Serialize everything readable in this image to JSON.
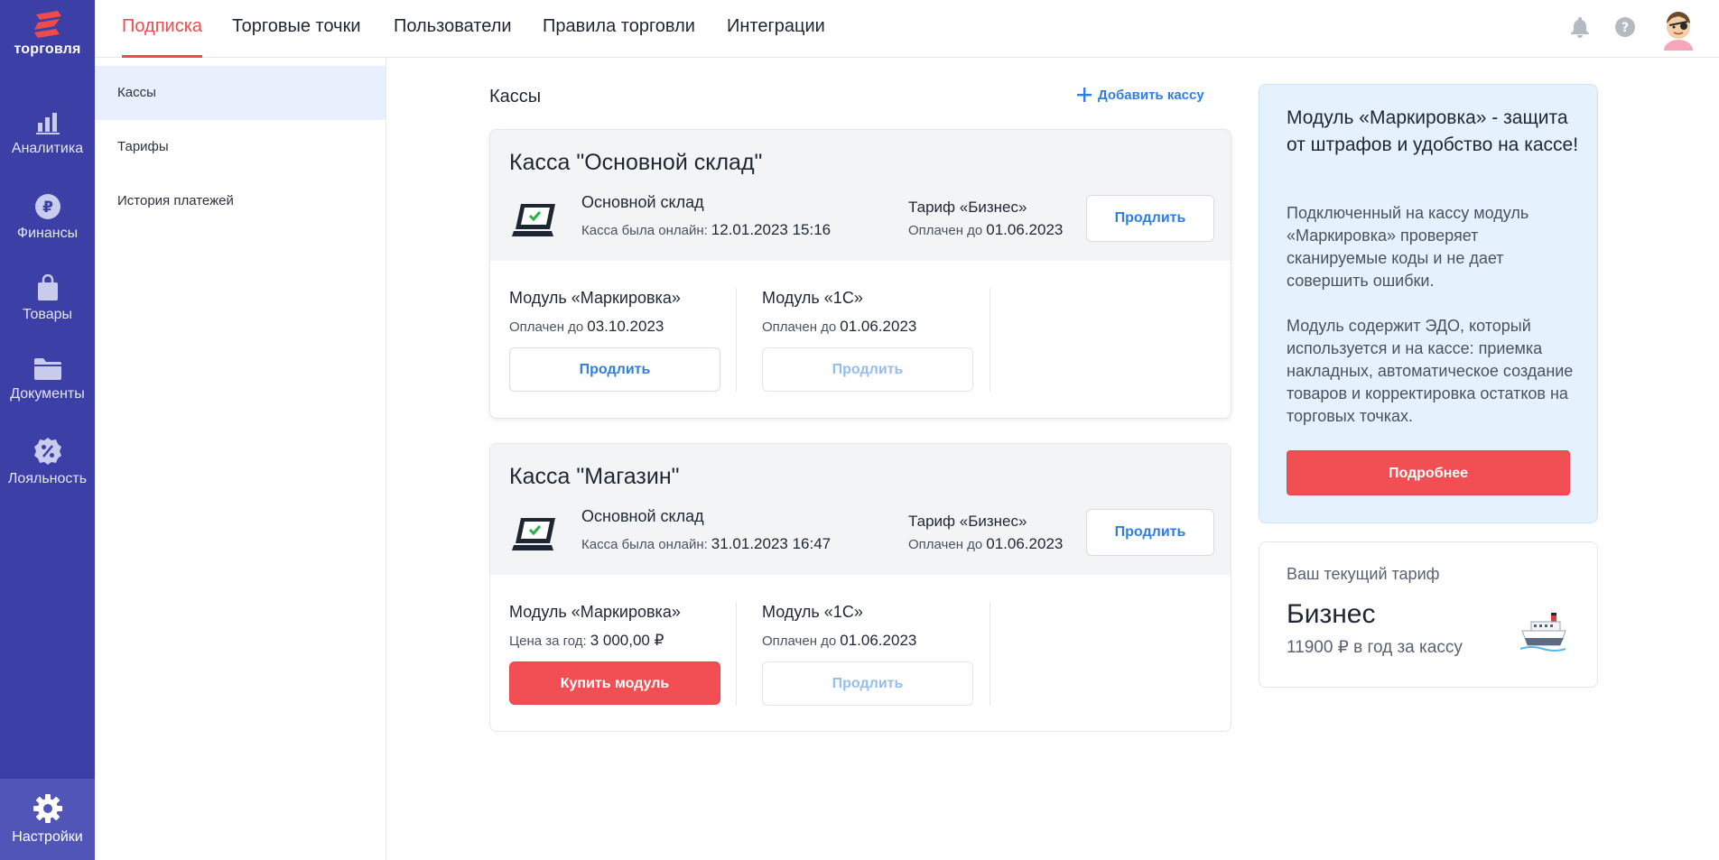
{
  "brand": {
    "logo_text": "торговля"
  },
  "rail": {
    "items": [
      {
        "label": "Аналитика",
        "icon": "chart-bar-icon"
      },
      {
        "label": "Финансы",
        "icon": "ruble-icon"
      },
      {
        "label": "Товары",
        "icon": "shopping-bag-icon"
      },
      {
        "label": "Документы",
        "icon": "folder-icon"
      },
      {
        "label": "Лояльность",
        "icon": "discount-badge-icon"
      }
    ],
    "settings": {
      "label": "Настройки",
      "icon": "gear-icon"
    }
  },
  "topnav": {
    "tabs": [
      {
        "label": "Подписка",
        "active": true
      },
      {
        "label": "Торговые точки"
      },
      {
        "label": "Пользователи"
      },
      {
        "label": "Правила торговли"
      },
      {
        "label": "Интеграции"
      }
    ]
  },
  "subnav": {
    "items": [
      {
        "label": "Кассы",
        "active": true
      },
      {
        "label": "Тарифы"
      },
      {
        "label": "История платежей"
      }
    ]
  },
  "main": {
    "title": "Кассы",
    "add_button": "Добавить кассу",
    "cards": [
      {
        "title": "Касса \"Основной склад\"",
        "store": "Основной склад",
        "online_label": "Касса была онлайн:",
        "online_value": "12.01.2023 15:16",
        "tariff": "Тариф «Бизнес»",
        "paid_label": "Оплачен до",
        "paid_value": "01.06.2023",
        "renew": "Продлить",
        "modules": [
          {
            "title": "Модуль «Маркировка»",
            "label": "Оплачен до",
            "value": "03.10.2023",
            "button": "Продлить",
            "state": "active"
          },
          {
            "title": "Модуль «1С»",
            "label": "Оплачен до",
            "value": "01.06.2023",
            "button": "Продлить",
            "state": "disabled"
          }
        ]
      },
      {
        "title": "Касса \"Магазин\"",
        "store": "Основной склад",
        "online_label": "Касса была онлайн:",
        "online_value": "31.01.2023 16:47",
        "tariff": "Тариф «Бизнес»",
        "paid_label": "Оплачен до",
        "paid_value": "01.06.2023",
        "renew": "Продлить",
        "modules": [
          {
            "title": "Модуль «Маркировка»",
            "label": "Цена за год:",
            "value": "3 000,00 ₽",
            "button": "Купить модуль",
            "state": "buy"
          },
          {
            "title": "Модуль «1С»",
            "label": "Оплачен до",
            "value": "01.06.2023",
            "button": "Продлить",
            "state": "disabled"
          }
        ]
      }
    ]
  },
  "promo": {
    "title": "Модуль «Маркировка» - защита от штрафов и удобство на кассе!",
    "p1": "Подключенный на кассу модуль «Маркировка» проверяет сканируемые коды и не дает совершить ошибки.",
    "p2": "Модуль содержит ЭДО, который используется и на кассе: приемка накладных, автоматическое создание товаров и корректировка остатков на торговых точках.",
    "button": "Подробнее"
  },
  "current_tariff": {
    "label": "Ваш текущий тариф",
    "name": "Бизнес",
    "price": "11900 ₽ в год за кассу"
  },
  "colors": {
    "rail": "#3c3fa5",
    "accent_red": "#f24f55",
    "link_blue": "#2f7ee6",
    "promo_bg": "#e5f1fc"
  }
}
